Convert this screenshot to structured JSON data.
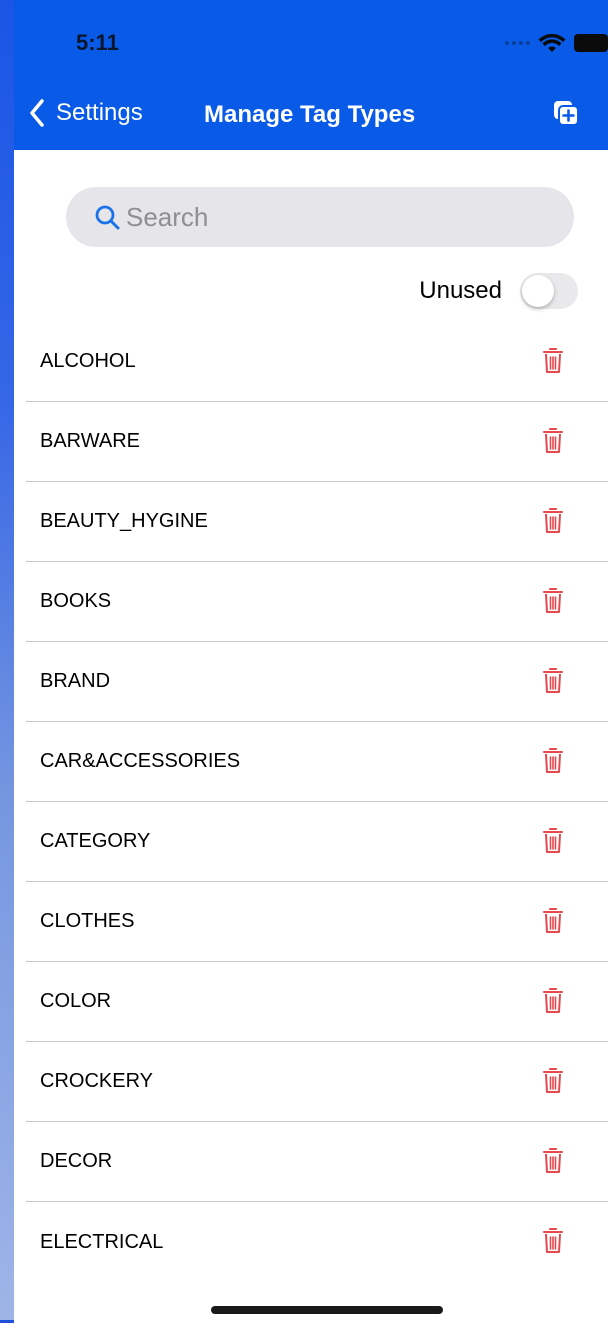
{
  "status_bar": {
    "time": "5:11"
  },
  "nav": {
    "back_label": "Settings",
    "title": "Manage Tag Types",
    "back_icon": "chevron-left-icon",
    "add_icon": "add-copy-icon"
  },
  "search": {
    "placeholder": "Search",
    "value": ""
  },
  "filter": {
    "unused_label": "Unused",
    "unused_on": false
  },
  "tag_types": [
    {
      "label": "ALCOHOL"
    },
    {
      "label": "BARWARE"
    },
    {
      "label": "BEAUTY_HYGINE"
    },
    {
      "label": "BOOKS"
    },
    {
      "label": "BRAND"
    },
    {
      "label": "CAR&ACCESSORIES"
    },
    {
      "label": "CATEGORY"
    },
    {
      "label": "CLOTHES"
    },
    {
      "label": "COLOR"
    },
    {
      "label": "CROCKERY"
    },
    {
      "label": "DECOR"
    },
    {
      "label": "ELECTRICAL"
    }
  ],
  "colors": {
    "accent": "#0a5ae8",
    "delete": "#e5484d",
    "search_icon": "#1a73e8"
  }
}
